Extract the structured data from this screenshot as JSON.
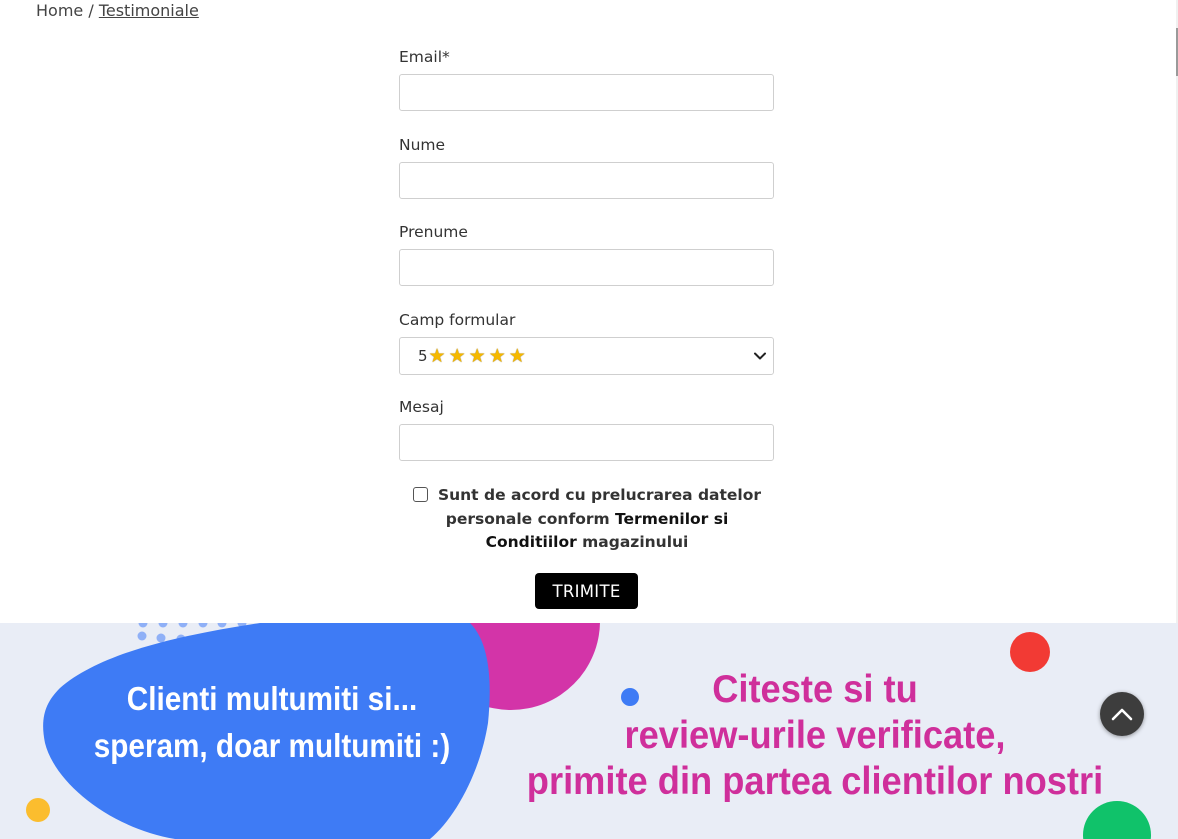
{
  "breadcrumb": {
    "home": "Home",
    "separator": " / ",
    "current": "Testimoniale"
  },
  "form": {
    "email_label": "Email*",
    "email_value": "",
    "nume_label": "Nume",
    "nume_value": "",
    "prenume_label": "Prenume",
    "prenume_value": "",
    "rating_label": "Camp formular",
    "rating_selected": "5",
    "rating_stars": 5,
    "mesaj_label": "Mesaj",
    "mesaj_value": "",
    "consent_checked": false,
    "consent_text": "Sunt de acord cu prelucrarea datelor personale conform ",
    "consent_link": "Termenilor si Conditiilor",
    "consent_suffix": " magazinului",
    "submit_label": "TRIMITE"
  },
  "banner": {
    "left_line1": "Clienti multumiti si...",
    "left_line2": "speram, doar multumiti :)",
    "right_line1": "Citeste si tu",
    "right_line2": "review-urile verificate,",
    "right_line3": "primite din partea clientilor nostri"
  },
  "icons": [
    "star-icon",
    "chevron-down-icon",
    "arrow-up-icon"
  ],
  "colors": {
    "submit_bg": "#000000",
    "banner_bg": "#e9edf6",
    "banner_blob_blue": "#3e7bf5",
    "banner_accent_magenta": "#cf2f9b",
    "to_top_bg": "#3d3d3d"
  }
}
